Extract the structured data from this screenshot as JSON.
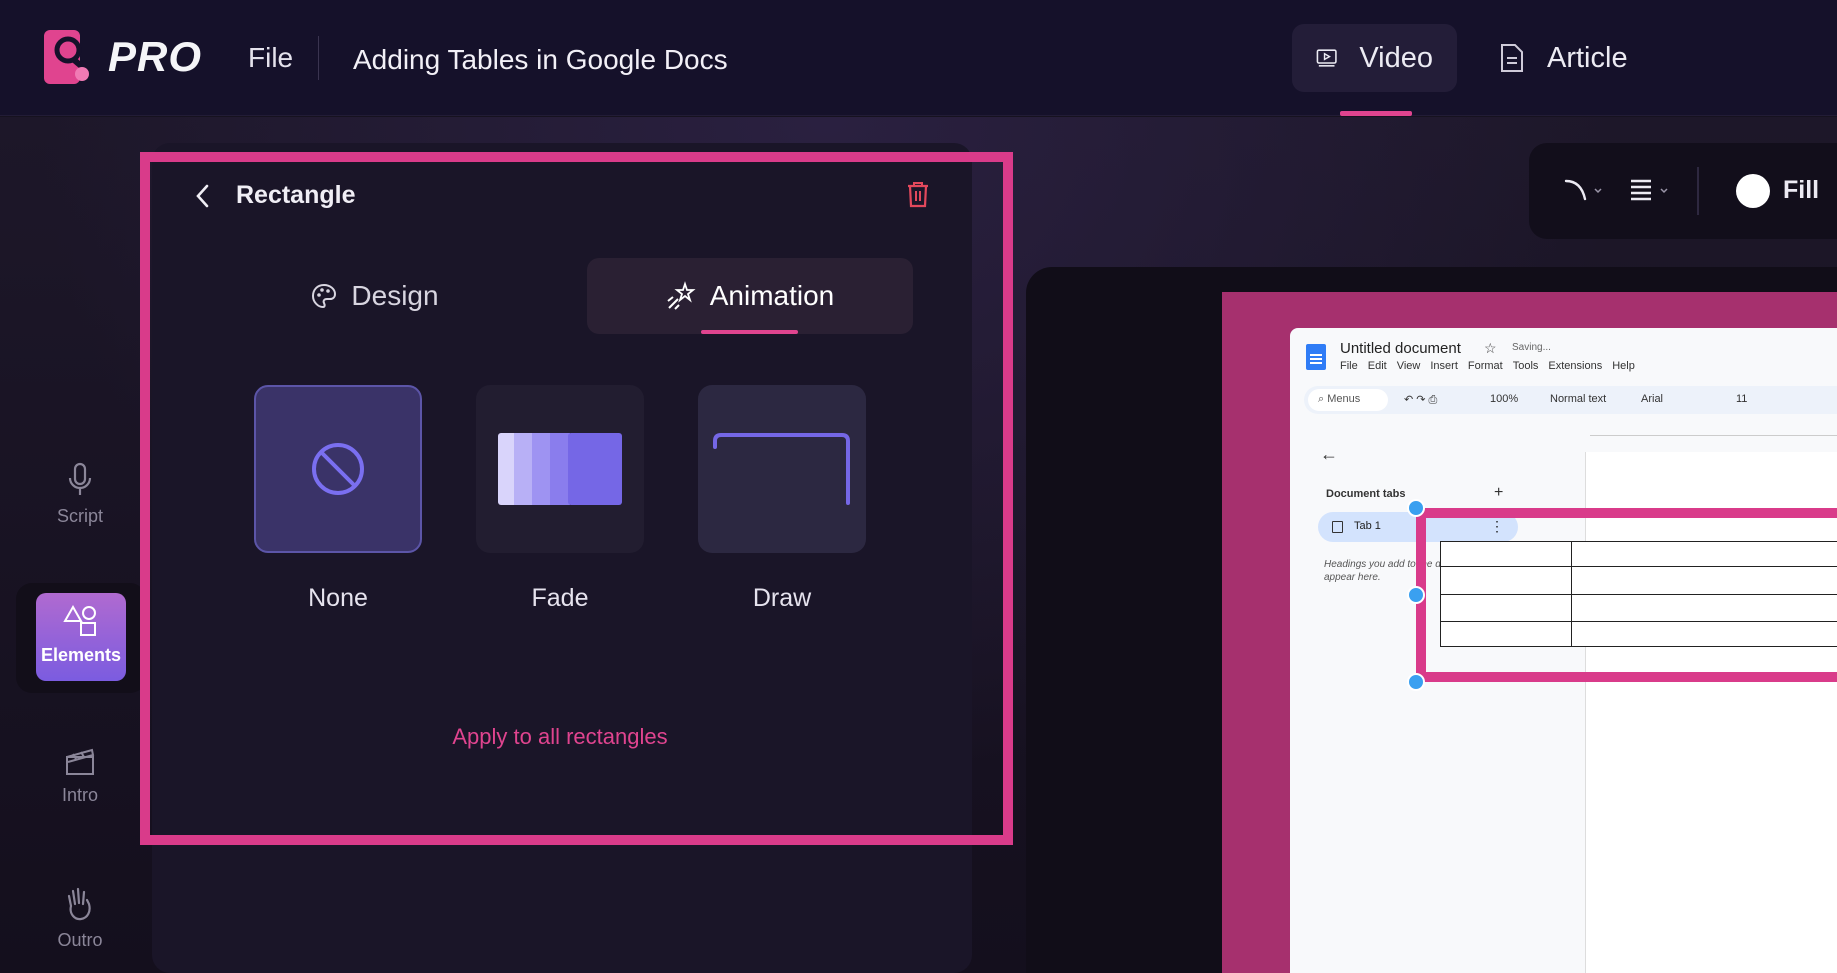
{
  "app": {
    "brand": "PRO",
    "file_menu": "File",
    "document_title": "Adding Tables in Google Docs"
  },
  "mode_tabs": [
    {
      "label": "Video",
      "icon": "video-icon",
      "active": true
    },
    {
      "label": "Article",
      "icon": "article-icon",
      "active": false
    }
  ],
  "rail": {
    "script": "Script",
    "elements": "Elements",
    "intro": "Intro",
    "outro": "Outro"
  },
  "panel": {
    "title": "Rectangle",
    "tabs": {
      "design": "Design",
      "animation": "Animation"
    },
    "active_tab": "Animation",
    "animations": [
      {
        "label": "None",
        "selected": true
      },
      {
        "label": "Fade",
        "selected": false
      },
      {
        "label": "Draw",
        "selected": false
      }
    ],
    "apply_all": "Apply to all rectangles"
  },
  "toolbar": {
    "fill_label": "Fill"
  },
  "preview": {
    "doc_title": "Untitled document",
    "saving": "Saving...",
    "menus": [
      "File",
      "Edit",
      "View",
      "Insert",
      "Format",
      "Tools",
      "Extensions",
      "Help"
    ],
    "search_placeholder": "Menus",
    "zoom": "100%",
    "style": "Normal text",
    "font": "Arial",
    "font_size": "11",
    "doc_tabs_header": "Document tabs",
    "tab_name": "Tab 1",
    "hint": "Headings you add to the document will appear here."
  },
  "colors": {
    "accent": "#e0448f",
    "highlight": "#d93b8a",
    "selected_card": "#3a3368",
    "rail_active_start": "#b06ad0",
    "rail_active_end": "#7b5ce0"
  }
}
